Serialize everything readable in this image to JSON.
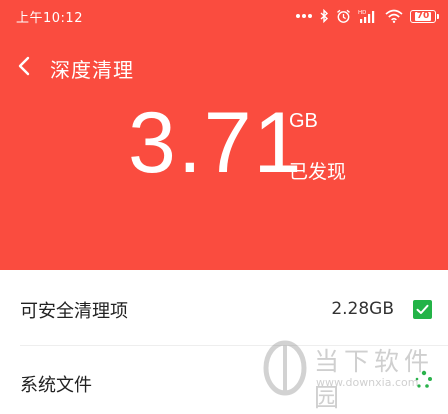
{
  "status_bar": {
    "time": "上午10:12",
    "battery_level": "70",
    "network_badge": "HD",
    "icons": [
      "more-dots-icon",
      "bluetooth-icon",
      "alarm-icon",
      "signal-icon",
      "wifi-icon",
      "battery-icon"
    ]
  },
  "header": {
    "title": "深度清理",
    "back_icon": "chevron-left-icon"
  },
  "summary": {
    "size": "3.71",
    "unit": "GB",
    "label": "已发现"
  },
  "items": [
    {
      "label": "可安全清理项",
      "size": "2.28GB",
      "checked": true
    },
    {
      "label": "系统文件",
      "size": "",
      "loading": true
    }
  ],
  "watermark": {
    "text": "当下软件园",
    "url": "www.downxia.com"
  },
  "colors": {
    "hero_bg": "#fa4c3f",
    "checkbox_green": "#23b347",
    "spinner_green": "#2bb24c"
  }
}
